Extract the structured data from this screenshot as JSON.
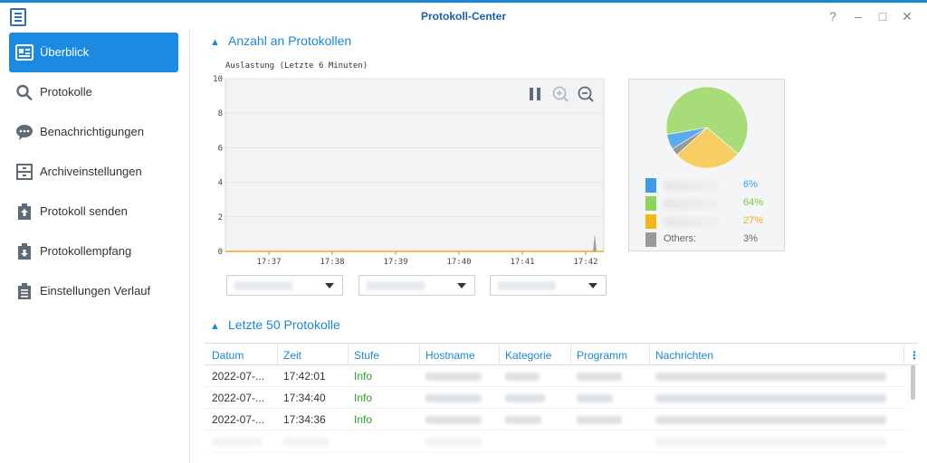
{
  "window": {
    "title": "Protokoll-Center",
    "controls": [
      "?",
      "–",
      "□",
      "✕"
    ]
  },
  "sidebar": {
    "items": [
      {
        "label": "Überblick",
        "icon": "overview-icon",
        "active": true
      },
      {
        "label": "Protokolle",
        "icon": "search-icon",
        "active": false
      },
      {
        "label": "Benachrichtigungen",
        "icon": "chat-bubble-icon",
        "active": false
      },
      {
        "label": "Archiveinstellungen",
        "icon": "archive-drawer-icon",
        "active": false
      },
      {
        "label": "Protokoll senden",
        "icon": "clipboard-upload-icon",
        "active": false
      },
      {
        "label": "Protokollempfang",
        "icon": "clipboard-download-icon",
        "active": false
      },
      {
        "label": "Einstellungen Verlauf",
        "icon": "clipboard-list-icon",
        "active": false
      }
    ]
  },
  "sections": {
    "log_count": "Anzahl an Protokollen",
    "last_logs": "Letzte 50 Protokolle"
  },
  "chart_data": [
    {
      "type": "line",
      "title": "Auslastung (Letzte 6 Minuten)",
      "x": [
        "17:37",
        "17:38",
        "17:39",
        "17:40",
        "17:41",
        "17:42"
      ],
      "ylim": [
        0,
        10
      ],
      "yticks": [
        0,
        2,
        4,
        6,
        8,
        10
      ],
      "series": [
        {
          "color": "#f5a623",
          "values": [
            0,
            0,
            0,
            0,
            0,
            0
          ]
        },
        {
          "color": "#9e9e9e",
          "spike": {
            "x": "17:42",
            "value": 1
          }
        }
      ],
      "grid": true
    },
    {
      "type": "pie",
      "slices": [
        {
          "label": "",
          "value": 6,
          "pct": "6%",
          "color": "#5aaaf0"
        },
        {
          "label": "",
          "value": 64,
          "pct": "64%",
          "color": "#a8dc78"
        },
        {
          "label": "",
          "value": 27,
          "pct": "27%",
          "color": "#f6ce62"
        },
        {
          "label": "Others:",
          "value": 3,
          "pct": "3%",
          "color": "#9a9a9a"
        }
      ]
    }
  ],
  "chart_controls": [
    "pause-icon",
    "zoom-in-icon",
    "zoom-out-icon"
  ],
  "dropdowns": [
    {
      "value": ""
    },
    {
      "value": ""
    },
    {
      "value": ""
    }
  ],
  "table": {
    "columns": [
      "Datum",
      "Zeit",
      "Stufe",
      "Hostname",
      "Kategorie",
      "Programm",
      "Nachrichten"
    ],
    "rows": [
      {
        "datum": "2022-07-...",
        "zeit": "17:42:01",
        "stufe": "Info"
      },
      {
        "datum": "2022-07-...",
        "zeit": "17:34:40",
        "stufe": "Info"
      },
      {
        "datum": "2022-07-...",
        "zeit": "17:34:36",
        "stufe": "Info"
      }
    ],
    "menu_icon": "column-menu-icon"
  },
  "colors": {
    "accent": "#1a87d6",
    "active_nav": "#1b8ae0",
    "info": "#2f9a2f"
  }
}
